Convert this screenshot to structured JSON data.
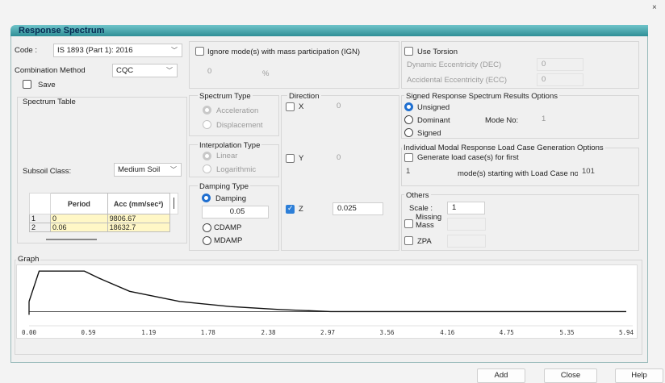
{
  "window": {
    "title": "Response Spectrum",
    "close_glyph": "×"
  },
  "code": {
    "label": "Code :",
    "value": "IS 1893 (Part 1): 2016"
  },
  "combination": {
    "label": "Combination Method",
    "value": "CQC"
  },
  "save_label": "Save",
  "spectrum_table_title": "Spectrum Table",
  "subsoil": {
    "label": "Subsoil Class:",
    "value": "Medium Soil"
  },
  "table": {
    "headers": [
      "Period",
      "Acc (mm/sec²)"
    ],
    "rows": [
      {
        "n": "1",
        "period": "0",
        "acc": "9806.67"
      },
      {
        "n": "2",
        "period": "0.06",
        "acc": "18632.7"
      }
    ]
  },
  "ignore_modes_label": "Ignore mode(s) with mass participation (IGN)",
  "ignore_value": "0",
  "ignore_unit": "%",
  "spectrum_type": {
    "title": "Spectrum Type",
    "options": [
      "Acceleration",
      "Displacement"
    ]
  },
  "interpolation": {
    "title": "Interpolation Type",
    "options": [
      "Linear",
      "Logarithmic"
    ]
  },
  "damping": {
    "title": "Damping Type",
    "options": [
      "Damping",
      "CDAMP",
      "MDAMP"
    ],
    "value": "0.05"
  },
  "direction": {
    "title": "Direction",
    "x": {
      "label": "X",
      "value": "0"
    },
    "y": {
      "label": "Y",
      "value": "0"
    },
    "z": {
      "label": "Z",
      "value": "0.025"
    }
  },
  "torsion": {
    "label": "Use Torsion",
    "dec_label": "Dynamic Eccentricity (DEC)",
    "dec_value": "0",
    "ecc_label": "Accidental Eccentricity (ECC)",
    "ecc_value": "0"
  },
  "signed": {
    "title": "Signed Response Spectrum Results Options",
    "options": [
      "Unsigned",
      "Dominant",
      "Signed"
    ],
    "mode_label": "Mode No:",
    "mode_value": "1"
  },
  "modal": {
    "title": "Individual Modal Response Load Case Generation Options",
    "generate_label": "Generate load case(s) for first",
    "count": "1",
    "starting_label": "mode(s) starting with Load Case no.",
    "start_value": "101"
  },
  "others": {
    "title": "Others",
    "scale_label": "Scale :",
    "scale_value": "1",
    "missing_mass_label": "Missing Mass",
    "zpa_label": "ZPA"
  },
  "graph": {
    "title": "Graph",
    "x_ticks": [
      "0.00",
      "0.59",
      "1.19",
      "1.78",
      "2.38",
      "2.97",
      "3.56",
      "4.16",
      "4.75",
      "5.35",
      "5.94"
    ]
  },
  "buttons": {
    "add": "Add",
    "close": "Close",
    "help": "Help"
  },
  "colors": {
    "title_gradient_top": "#6fc4c9",
    "title_gradient_bottom": "#2f8e96",
    "accent": "#1f6fd0",
    "table_highlight": "#fff7c6"
  },
  "chart_data": {
    "type": "line",
    "x": [
      0.0,
      0.06,
      0.1,
      0.55,
      0.7,
      1.0,
      1.5,
      2.0,
      2.5,
      3.0,
      3.56,
      4.16,
      4.75,
      5.35,
      5.94
    ],
    "series": [
      {
        "values": [
          9806.67,
          18632.7,
          24516.7,
          24516.7,
          21014.3,
          14710.0,
          9806.67,
          7355.0,
          5884.0,
          4903.3,
          4903.3,
          4903.3,
          4903.3,
          4903.3,
          4903.3
        ]
      }
    ],
    "x_ticks": [
      "0.00",
      "0.59",
      "1.19",
      "1.78",
      "2.38",
      "2.97",
      "3.56",
      "4.16",
      "4.75",
      "5.35",
      "5.94"
    ],
    "xlim": [
      0,
      5.94
    ],
    "ylim": [
      0,
      25000
    ],
    "baseline": 4903.3
  }
}
